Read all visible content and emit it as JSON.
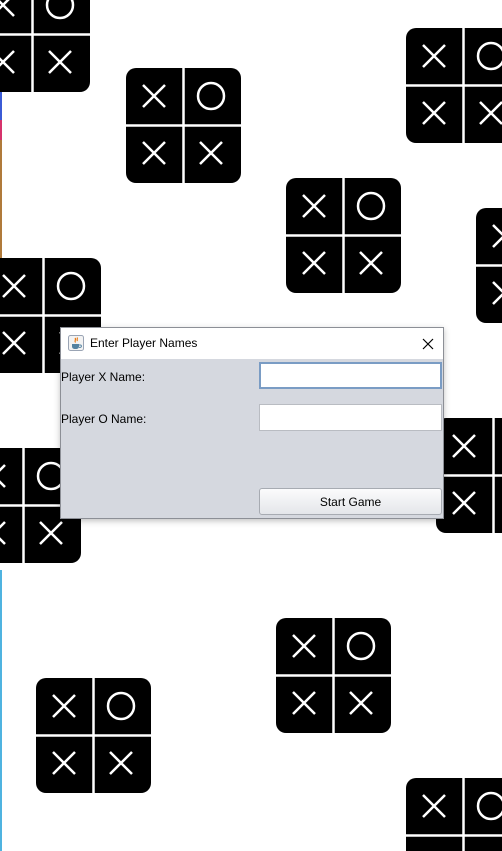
{
  "dialog": {
    "title": "Enter Player Names",
    "title_icon": "java-coffee-cup-icon",
    "close_icon": "close-icon",
    "player_x_label": "Player X Name:",
    "player_x_value": "",
    "player_o_label": "Player O Name:",
    "player_o_value": "",
    "start_button_label": "Start Game"
  },
  "background": {
    "tile_pattern": [
      "X",
      "O",
      "X",
      "X"
    ],
    "tile_color": "#000000",
    "mark_color": "#ffffff"
  },
  "colors": {
    "dialog_background": "#d5d8df",
    "focused_input_border": "#7a9cc4"
  }
}
